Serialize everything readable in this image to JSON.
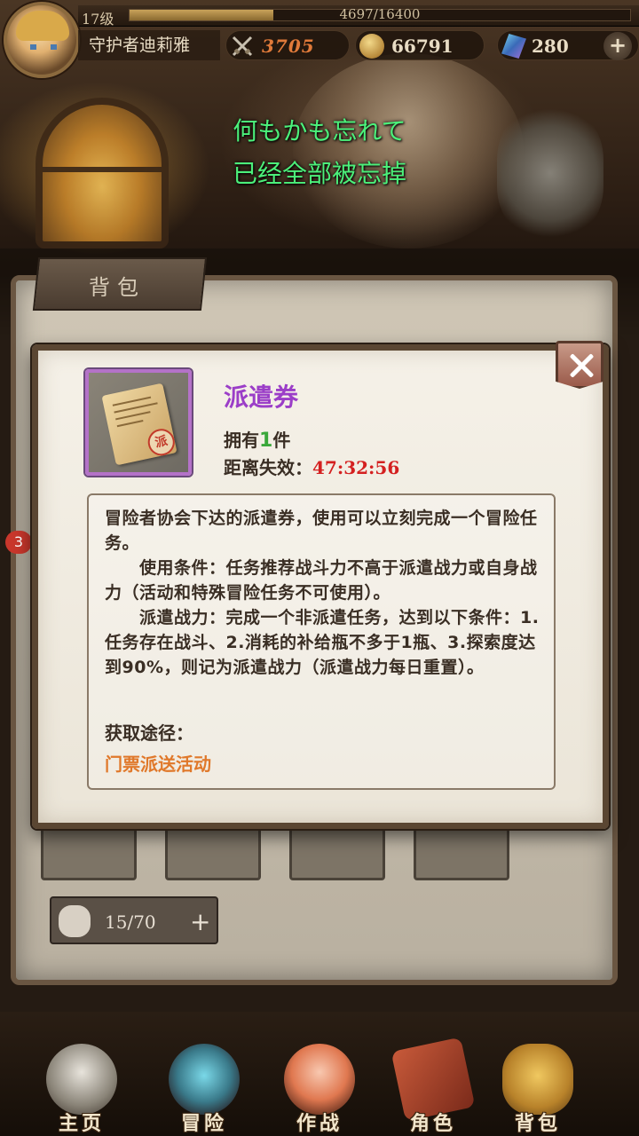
{
  "player": {
    "level": "17级",
    "exp_text": "4697/16400",
    "exp_progress": 0.2864,
    "name": "守护者迪莉雅",
    "combat_power": "3705",
    "gold": "66791",
    "gems": "280",
    "add_symbol": "+"
  },
  "subtitle": {
    "line1": "何もかも忘れて",
    "line2": "已经全部被忘掉"
  },
  "bag": {
    "tab_label": "背包",
    "capacity": "15/70",
    "add_symbol": "+",
    "side_badge": "3"
  },
  "item": {
    "name": "派遣券",
    "own_prefix": "拥有",
    "own_count": "1",
    "own_suffix": "件",
    "expire_label": "距离失效：",
    "expire_time": "47:32:56",
    "seal_char": "派",
    "description": "冒险者协会下达的派遣券，使用可以立刻完成一个冒险任务。\n　　使用条件：任务推荐战斗力不高于派遣战力或自身战力（活动和特殊冒险任务不可使用）。\n　　派遣战力：完成一个非派遣任务，达到以下条件：1.任务存在战斗、2.消耗的补给瓶不多于1瓶、3.探索度达到90%，则记为派遣战力（派遣战力每日重置）。",
    "obtain_label": "获取途径：",
    "obtain_source": "门票派送活动"
  },
  "nav": [
    {
      "label": "主页",
      "icon": "home-statue-icon"
    },
    {
      "label": "冒险",
      "icon": "adventure-gate-icon"
    },
    {
      "label": "作战",
      "icon": "battle-heroine-icon"
    },
    {
      "label": "角色",
      "icon": "character-book-icon"
    },
    {
      "label": "背包",
      "icon": "backpack-icon"
    }
  ],
  "colors": {
    "subtitle": "#4cf07a",
    "item_name": "#9b3ec8",
    "expire_time": "#d42020",
    "owned_count": "#3aa83a",
    "obtain_source": "#e0782a"
  }
}
